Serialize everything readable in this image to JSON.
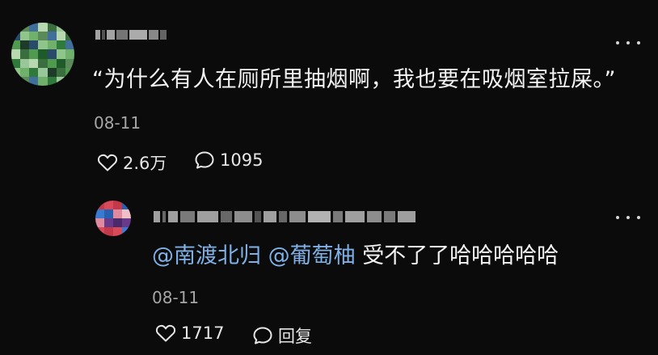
{
  "comment": {
    "text": "“为什么有人在厕所里抽烟啊，我也要在吸烟室拉屎。”",
    "date": "08-11",
    "likes": "2.6万",
    "replies": "1095",
    "icons": {
      "more": "more-dots-icon",
      "like": "heart-outline-icon",
      "comment": "speech-bubble-icon"
    }
  },
  "reply": {
    "mention1": "@南渡北归",
    "mention2": "@葡萄柚",
    "text": "受不了了哈哈哈哈哈",
    "date": "08-11",
    "likes": "1717",
    "reply_label": "回复"
  },
  "colors": {
    "background": "#0b0b0c",
    "text": "#f4f4f4",
    "muted": "#a6a6a6",
    "mention": "#7fb0e6"
  }
}
